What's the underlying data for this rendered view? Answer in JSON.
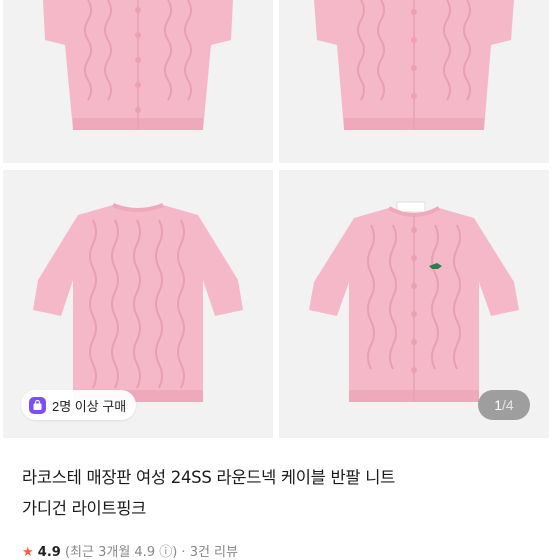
{
  "product": {
    "images": [
      {
        "alt": "cardigan-front-buttoned"
      },
      {
        "alt": "cardigan-front-buttoned-angle"
      },
      {
        "alt": "cardigan-back"
      },
      {
        "alt": "cardigan-front-logo"
      }
    ],
    "badge": {
      "icon": "shopping-bag-icon",
      "label": "2명 이상 구매"
    },
    "pager": {
      "current": "1",
      "total": "/4"
    },
    "title_line1": "라코스테 매장판 여성 24SS 라운드넥 케이블 반팔 니트",
    "title_line2": "가디건 라이트핑크",
    "meta": {
      "star": "★",
      "rating": "4.9",
      "rest": "(최근 3개월 4.9 ⓘ) · 3건 리뷰"
    }
  },
  "colors": {
    "knit": "#f5b8c8",
    "knit_dark": "#e89fb2",
    "badge_icon": "#7c4dff",
    "star": "#ff5a3c"
  }
}
